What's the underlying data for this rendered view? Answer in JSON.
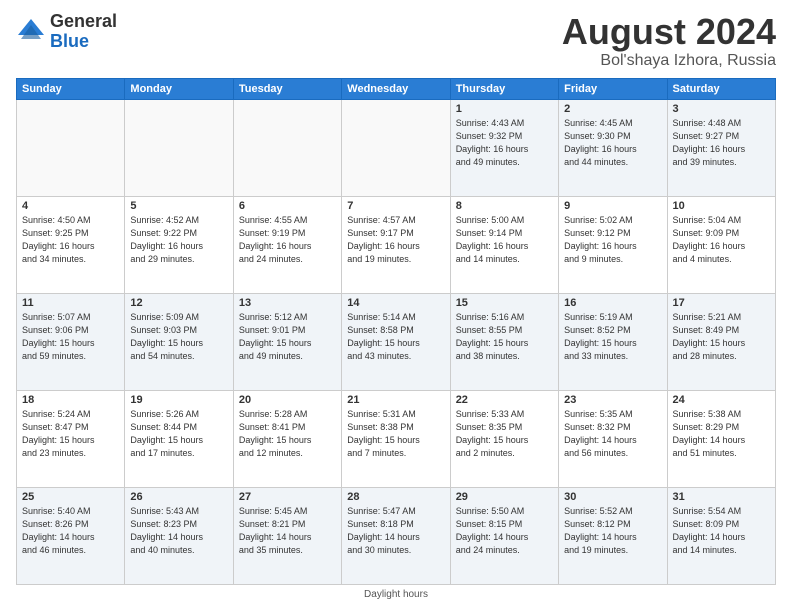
{
  "logo": {
    "general": "General",
    "blue": "Blue"
  },
  "title": "August 2024",
  "location": "Bol'shaya Izhora, Russia",
  "days_of_week": [
    "Sunday",
    "Monday",
    "Tuesday",
    "Wednesday",
    "Thursday",
    "Friday",
    "Saturday"
  ],
  "footer": "Daylight hours",
  "weeks": [
    [
      {
        "num": "",
        "info": ""
      },
      {
        "num": "",
        "info": ""
      },
      {
        "num": "",
        "info": ""
      },
      {
        "num": "",
        "info": ""
      },
      {
        "num": "1",
        "info": "Sunrise: 4:43 AM\nSunset: 9:32 PM\nDaylight: 16 hours\nand 49 minutes."
      },
      {
        "num": "2",
        "info": "Sunrise: 4:45 AM\nSunset: 9:30 PM\nDaylight: 16 hours\nand 44 minutes."
      },
      {
        "num": "3",
        "info": "Sunrise: 4:48 AM\nSunset: 9:27 PM\nDaylight: 16 hours\nand 39 minutes."
      }
    ],
    [
      {
        "num": "4",
        "info": "Sunrise: 4:50 AM\nSunset: 9:25 PM\nDaylight: 16 hours\nand 34 minutes."
      },
      {
        "num": "5",
        "info": "Sunrise: 4:52 AM\nSunset: 9:22 PM\nDaylight: 16 hours\nand 29 minutes."
      },
      {
        "num": "6",
        "info": "Sunrise: 4:55 AM\nSunset: 9:19 PM\nDaylight: 16 hours\nand 24 minutes."
      },
      {
        "num": "7",
        "info": "Sunrise: 4:57 AM\nSunset: 9:17 PM\nDaylight: 16 hours\nand 19 minutes."
      },
      {
        "num": "8",
        "info": "Sunrise: 5:00 AM\nSunset: 9:14 PM\nDaylight: 16 hours\nand 14 minutes."
      },
      {
        "num": "9",
        "info": "Sunrise: 5:02 AM\nSunset: 9:12 PM\nDaylight: 16 hours\nand 9 minutes."
      },
      {
        "num": "10",
        "info": "Sunrise: 5:04 AM\nSunset: 9:09 PM\nDaylight: 16 hours\nand 4 minutes."
      }
    ],
    [
      {
        "num": "11",
        "info": "Sunrise: 5:07 AM\nSunset: 9:06 PM\nDaylight: 15 hours\nand 59 minutes."
      },
      {
        "num": "12",
        "info": "Sunrise: 5:09 AM\nSunset: 9:03 PM\nDaylight: 15 hours\nand 54 minutes."
      },
      {
        "num": "13",
        "info": "Sunrise: 5:12 AM\nSunset: 9:01 PM\nDaylight: 15 hours\nand 49 minutes."
      },
      {
        "num": "14",
        "info": "Sunrise: 5:14 AM\nSunset: 8:58 PM\nDaylight: 15 hours\nand 43 minutes."
      },
      {
        "num": "15",
        "info": "Sunrise: 5:16 AM\nSunset: 8:55 PM\nDaylight: 15 hours\nand 38 minutes."
      },
      {
        "num": "16",
        "info": "Sunrise: 5:19 AM\nSunset: 8:52 PM\nDaylight: 15 hours\nand 33 minutes."
      },
      {
        "num": "17",
        "info": "Sunrise: 5:21 AM\nSunset: 8:49 PM\nDaylight: 15 hours\nand 28 minutes."
      }
    ],
    [
      {
        "num": "18",
        "info": "Sunrise: 5:24 AM\nSunset: 8:47 PM\nDaylight: 15 hours\nand 23 minutes."
      },
      {
        "num": "19",
        "info": "Sunrise: 5:26 AM\nSunset: 8:44 PM\nDaylight: 15 hours\nand 17 minutes."
      },
      {
        "num": "20",
        "info": "Sunrise: 5:28 AM\nSunset: 8:41 PM\nDaylight: 15 hours\nand 12 minutes."
      },
      {
        "num": "21",
        "info": "Sunrise: 5:31 AM\nSunset: 8:38 PM\nDaylight: 15 hours\nand 7 minutes."
      },
      {
        "num": "22",
        "info": "Sunrise: 5:33 AM\nSunset: 8:35 PM\nDaylight: 15 hours\nand 2 minutes."
      },
      {
        "num": "23",
        "info": "Sunrise: 5:35 AM\nSunset: 8:32 PM\nDaylight: 14 hours\nand 56 minutes."
      },
      {
        "num": "24",
        "info": "Sunrise: 5:38 AM\nSunset: 8:29 PM\nDaylight: 14 hours\nand 51 minutes."
      }
    ],
    [
      {
        "num": "25",
        "info": "Sunrise: 5:40 AM\nSunset: 8:26 PM\nDaylight: 14 hours\nand 46 minutes."
      },
      {
        "num": "26",
        "info": "Sunrise: 5:43 AM\nSunset: 8:23 PM\nDaylight: 14 hours\nand 40 minutes."
      },
      {
        "num": "27",
        "info": "Sunrise: 5:45 AM\nSunset: 8:21 PM\nDaylight: 14 hours\nand 35 minutes."
      },
      {
        "num": "28",
        "info": "Sunrise: 5:47 AM\nSunset: 8:18 PM\nDaylight: 14 hours\nand 30 minutes."
      },
      {
        "num": "29",
        "info": "Sunrise: 5:50 AM\nSunset: 8:15 PM\nDaylight: 14 hours\nand 24 minutes."
      },
      {
        "num": "30",
        "info": "Sunrise: 5:52 AM\nSunset: 8:12 PM\nDaylight: 14 hours\nand 19 minutes."
      },
      {
        "num": "31",
        "info": "Sunrise: 5:54 AM\nSunset: 8:09 PM\nDaylight: 14 hours\nand 14 minutes."
      }
    ]
  ]
}
